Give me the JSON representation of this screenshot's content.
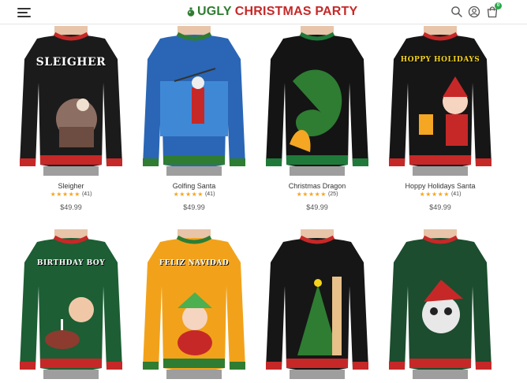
{
  "header": {
    "logo_ugly": "UGLY",
    "logo_rest": "CHRISTMAS PARTY",
    "cart_count": "0",
    "icons": [
      "menu-icon",
      "search-icon",
      "account-icon",
      "cart-icon"
    ]
  },
  "colors": {
    "brand_green": "#2e7d32",
    "brand_red": "#c62828",
    "star": "#f5a623",
    "badge": "#2ba84a"
  },
  "products": [
    {
      "name": "Sleigher",
      "stars": "★★★★★",
      "reviews": "(41)",
      "price": "$49.99",
      "print": "SLEIGHER",
      "sweater_color": "#1b1b1b",
      "accent": "#c62828"
    },
    {
      "name": "Golfing Santa",
      "stars": "★★★★★",
      "reviews": "(41)",
      "price": "$49.99",
      "print": "",
      "sweater_color": "#2a66b5",
      "accent": "#2e7d32"
    },
    {
      "name": "Christmas Dragon",
      "stars": "★★★★★",
      "reviews": "(25)",
      "price": "$49.99",
      "print": "",
      "sweater_color": "#141414",
      "accent": "#1f7a3a"
    },
    {
      "name": "Hoppy Holidays Santa",
      "stars": "★★★★★",
      "reviews": "(41)",
      "price": "$49.99",
      "print": "HOPPY HOLIDAYS",
      "sweater_color": "#161616",
      "accent": "#c62828"
    },
    {
      "name": "",
      "stars": "",
      "reviews": "",
      "price": "",
      "print": "BIRTHDAY BOY",
      "sweater_color": "#1d5e34",
      "accent": "#c62828"
    },
    {
      "name": "",
      "stars": "",
      "reviews": "",
      "price": "",
      "print": "FELIZ NAVIDAD",
      "sweater_color": "#f2a21a",
      "accent": "#c62828"
    },
    {
      "name": "",
      "stars": "",
      "reviews": "",
      "price": "",
      "print": "",
      "sweater_color": "#161616",
      "accent": "#c62828"
    },
    {
      "name": "",
      "stars": "",
      "reviews": "",
      "price": "",
      "print": "",
      "sweater_color": "#1b4d2e",
      "accent": "#c62828"
    }
  ]
}
